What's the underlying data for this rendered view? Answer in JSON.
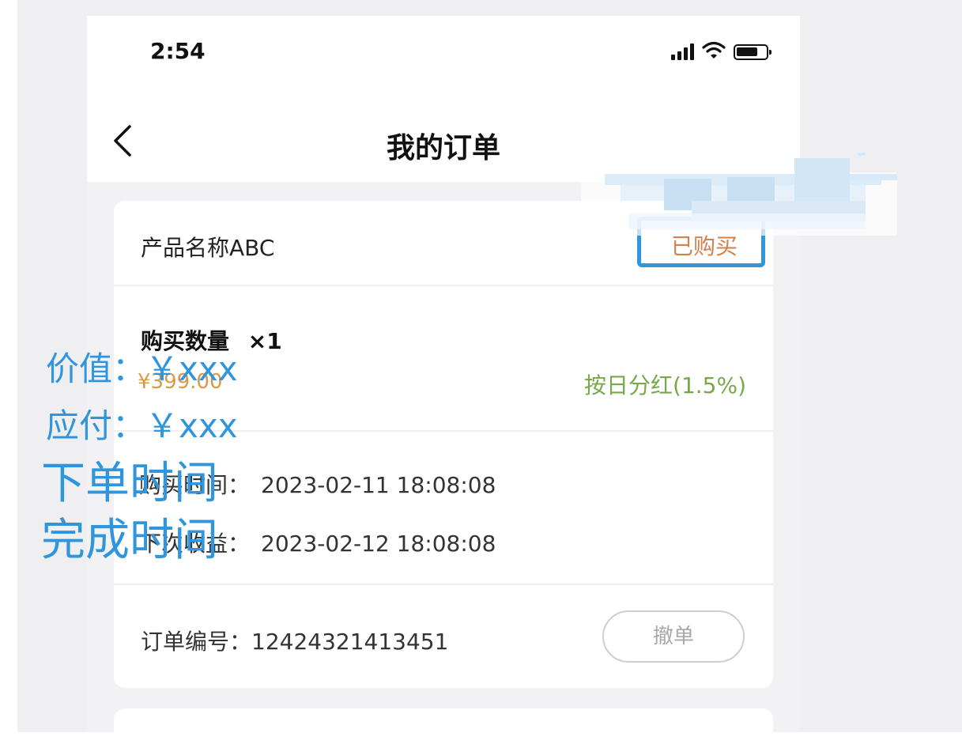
{
  "statusbar": {
    "time": "2:54"
  },
  "navbar": {
    "title": "我的订单"
  },
  "order": {
    "product_name": "产品名称ABC",
    "status": "已购买",
    "quantity_label": "购买数量",
    "quantity": "×1",
    "price": "¥399.00",
    "dividend": "按日分红(1.5%)",
    "purchase_time_label": "购买时间：",
    "purchase_time": "2023-02-11 18:08:08",
    "next_income_label": "下次收益：",
    "next_income_time": "2023-02-12 18:08:08",
    "order_number_label": "订单编号：",
    "order_number": "12424321413451",
    "cancel_label": "撤单"
  },
  "annotations": {
    "value": "价值：￥xxx",
    "payable": "应付：￥xxx",
    "order_time": "下单时间",
    "complete_time": "完成时间"
  },
  "colors": {
    "accent_blue": "#2f95dc",
    "status_orange": "#d4804a",
    "price_orange": "#d89a48",
    "dividend_green": "#78a84c"
  },
  "icons": [
    "back-chevron-icon",
    "signal-icon",
    "wifi-icon",
    "battery-icon"
  ]
}
